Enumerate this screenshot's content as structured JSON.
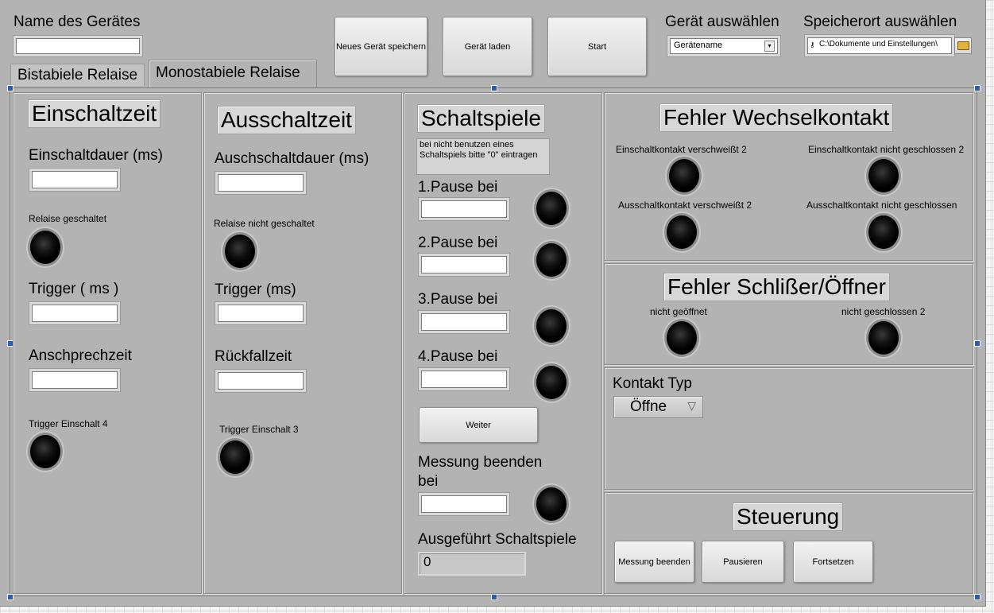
{
  "header": {
    "device_name_label": "Name des Gerätes",
    "device_name_value": "",
    "save_button": "Neues Gerät speichern",
    "load_button": "Gerät laden",
    "start_button": "Start",
    "select_device_label": "Gerät auswählen",
    "select_device_value": "Gerätename",
    "storage_label": "Speicherort auswählen",
    "storage_path": "C:\\Dokumente und Einstellungen\\"
  },
  "tabs": [
    {
      "label": "Bistabiele Relaise",
      "active": false
    },
    {
      "label": "Monostabiele Relaise",
      "active": true
    }
  ],
  "einschalt": {
    "title": "Einschaltzeit",
    "dauer_label": "Einschaltdauer (ms)",
    "relaise_label": "Relaise geschaltet",
    "trigger_label": "Trigger ( ms )",
    "ansprech_label": "Anschprechzeit",
    "trigger_einschalt_label": "Trigger Einschalt  4"
  },
  "ausschalt": {
    "title": "Ausschaltzeit",
    "dauer_label": "Auschschaltdauer (ms)",
    "relaise_label": "Relaise nicht geschaltet",
    "trigger_label": "Trigger (ms)",
    "rueckfall_label": "Rückfallzeit",
    "trigger_einschalt_label": "Trigger Einschalt  3"
  },
  "schaltspiele": {
    "title": "Schaltspiele",
    "note": "bei nicht benutzen eines Schaltspiels bitte \"0\" eintragen",
    "pauses": [
      "1.Pause bei",
      "2.Pause bei",
      "3.Pause bei",
      "4.Pause bei"
    ],
    "weiter_button": "Weiter",
    "messung_label": "Messung beenden bei",
    "ausgefuehrt_label": "Ausgeführt Schaltspiele",
    "ausgefuehrt_value": "0"
  },
  "wechsel": {
    "title": "Fehler Wechselkontakt",
    "labels": [
      "Einschaltkontakt verschweißt 2",
      "Einschaltkontakt nicht geschlossen 2",
      "Ausschaltkontakt verschweißt 2",
      "Ausschaltkontakt nicht geschlossen"
    ]
  },
  "schliesser": {
    "title": "Fehler Schlißer/Öffner",
    "labels": [
      "nicht geöffnet",
      "nicht geschlossen 2"
    ]
  },
  "kontakt": {
    "label": "Kontakt Typ",
    "value": "Öffne"
  },
  "steuerung": {
    "title": "Steuerung",
    "messung_button": "Messung beenden",
    "pause_button": "Pausieren",
    "fortsetzen_button": "Fortsetzen"
  }
}
